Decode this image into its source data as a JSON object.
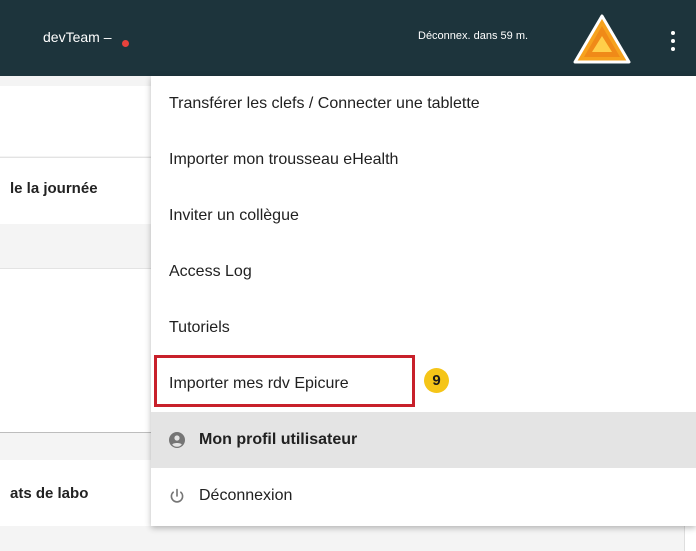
{
  "header": {
    "team_name": "devTeam –",
    "session_text": "Déconnex. dans 59 m.",
    "logo_icon": "orange-triangle-logo",
    "more_icon": "kebab-menu-icon",
    "status_color": "#e8423c",
    "bar_color": "#1d343c"
  },
  "background": {
    "heading_day": "le la journée",
    "heading_labo": "ats de labo"
  },
  "menu": {
    "items": [
      {
        "label": "Transférer les clefs / Connecter une tablette"
      },
      {
        "label": "Importer mon trousseau eHealth"
      },
      {
        "label": "Inviter un collègue"
      },
      {
        "label": "Access Log"
      },
      {
        "label": "Tutoriels"
      },
      {
        "label": "Importer mes rdv Epicure"
      },
      {
        "label": "Mon profil utilisateur",
        "icon": "account-circle-icon"
      },
      {
        "label": "Déconnexion",
        "icon": "power-icon"
      }
    ]
  },
  "annotation": {
    "step_number": "9",
    "highlight_color": "#c8202a",
    "badge_color": "#f5c518"
  }
}
